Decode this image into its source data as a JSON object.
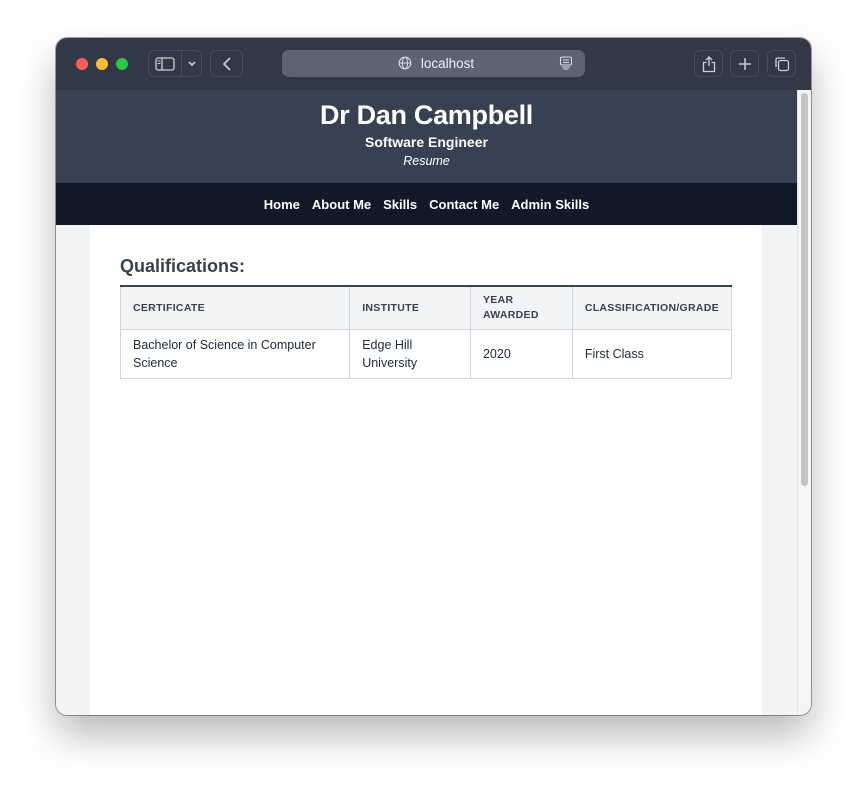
{
  "browser": {
    "url": "localhost"
  },
  "header": {
    "name": "Dr Dan Campbell",
    "role": "Software Engineer",
    "subtitle": "Resume"
  },
  "nav": {
    "items": [
      "Home",
      "About Me",
      "Skills",
      "Contact Me",
      "Admin Skills"
    ]
  },
  "qualifications": {
    "heading": "Qualifications:",
    "columns": [
      "CERTIFICATE",
      "INSTITUTE",
      "YEAR AWARDED",
      "CLASSIFICATION/GRADE"
    ],
    "rows": [
      {
        "certificate": "Bachelor of Science in Computer Science",
        "institute": "Edge Hill University",
        "year": "2020",
        "grade": "First Class"
      }
    ]
  }
}
